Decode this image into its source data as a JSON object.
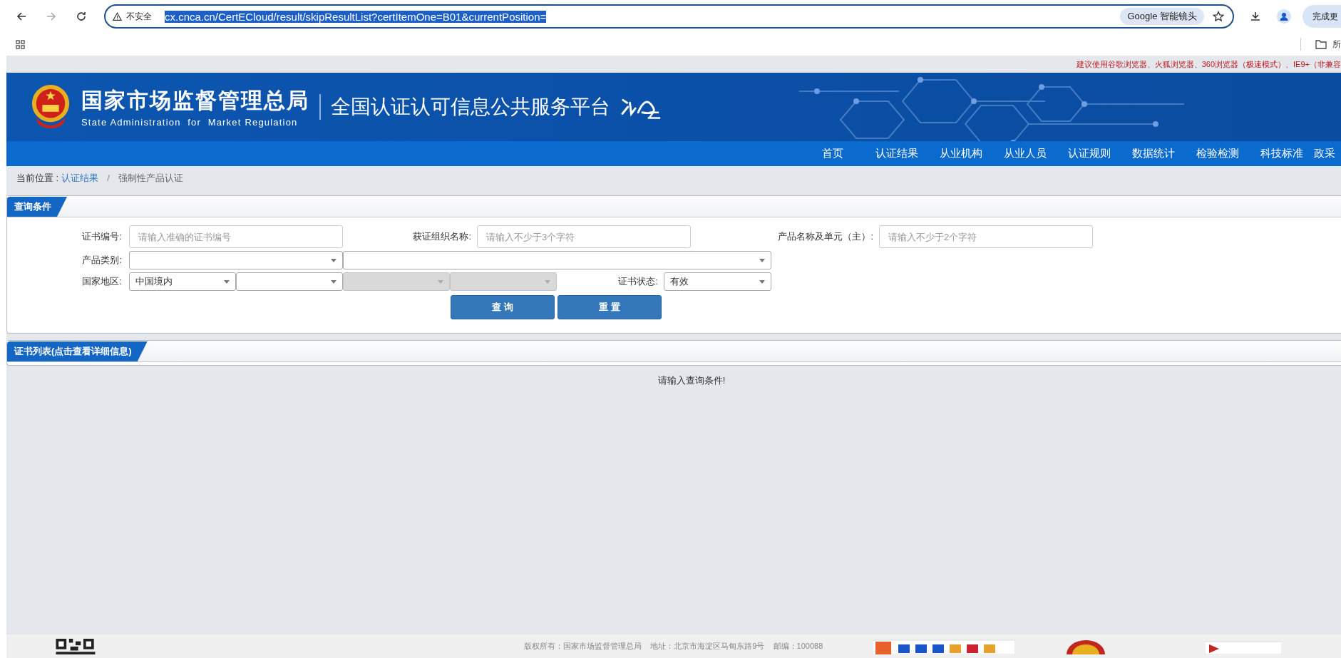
{
  "browser": {
    "security": "不安全",
    "url": "cx.cnca.cn/CertECloud/result/skipResultList?certItemOne=B01&currentPosition=",
    "lens": "Google 智能镜头",
    "action_button": "完成更",
    "bookmark": "所"
  },
  "notice": "建议使用谷歌浏览器、火狐浏览器、360浏览器（极速模式）、IE9+（非兼容",
  "header": {
    "title": "国家市场监督管理总局",
    "subtitle": "State Administration  for  Market Regulation",
    "platform": "全国认证认可信息公共服务平台"
  },
  "nav": [
    "首页",
    "认证结果",
    "从业机构",
    "从业人员",
    "认证规则",
    "数据统计",
    "检验检测",
    "科技标准",
    "政采"
  ],
  "breadcrumb": {
    "label": "当前位置 :",
    "items": [
      {
        "label": "认证结果",
        "kind": "link"
      },
      {
        "label": "强制性产品认证",
        "kind": "current"
      }
    ],
    "separator": "/"
  },
  "query": {
    "title": "查询条件",
    "fields": [
      {
        "label": "证书编号:",
        "placeholder": "请输入准确的证书编号"
      },
      {
        "label": "获证组织名称:",
        "placeholder": "请输入不少于3个字符"
      },
      {
        "label": "产品名称及单元（主）:",
        "placeholder": "请输入不少于2个字符"
      }
    ],
    "category": {
      "label": "产品类别:",
      "selects": [
        {
          "disabled": false
        },
        {
          "disabled": false
        }
      ]
    },
    "region": {
      "label": "国家地区:",
      "selects": [
        {
          "value": "中国境内",
          "disabled": false
        },
        {
          "disabled": false
        },
        {
          "disabled": true
        },
        {
          "disabled": true
        }
      ]
    },
    "status": {
      "label": "证书状态:",
      "value": "有效"
    },
    "buttons": [
      "查 询",
      "重 置"
    ]
  },
  "list": {
    "title": "证书列表(点击查看详细信息)",
    "message": "请输入查询条件!"
  },
  "footer": {
    "text": "版权所有：国家市场监督管理总局    地址：北京市海淀区马甸东路9号    邮编：100088"
  }
}
